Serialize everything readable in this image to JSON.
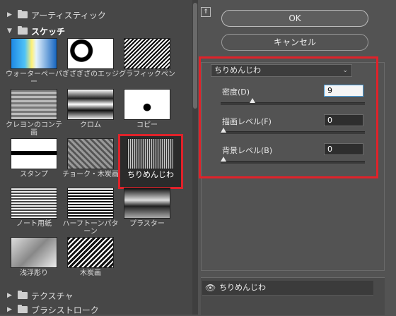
{
  "categories": {
    "artistic": "アーティスティック",
    "sketch": "スケッチ",
    "texture": "テクスチャ",
    "brush_stroke": "ブラシストローク"
  },
  "thumbnails": [
    {
      "label": "ウォーターペーパー"
    },
    {
      "label": "ぎざぎざのエッジ"
    },
    {
      "label": "グラフィックペン"
    },
    {
      "label": "クレヨンのコンテ画"
    },
    {
      "label": "クロム"
    },
    {
      "label": "コピー"
    },
    {
      "label": "スタンプ"
    },
    {
      "label": "チョーク・木炭画"
    },
    {
      "label": "ちりめんじわ"
    },
    {
      "label": "ノート用紙"
    },
    {
      "label": "ハーフトーンパターン"
    },
    {
      "label": "プラスター"
    },
    {
      "label": "浅浮彫り"
    },
    {
      "label": "木炭画"
    }
  ],
  "buttons": {
    "ok": "OK",
    "cancel": "キャンセル"
  },
  "filter_select": {
    "value": "ちりめんじわ"
  },
  "params": [
    {
      "label": "密度(D)",
      "value": "9",
      "level": 0.2
    },
    {
      "label": "描画レベル(F)",
      "value": "0",
      "level": 0.0
    },
    {
      "label": "背景レベル(B)",
      "value": "0",
      "level": 0.0
    }
  ],
  "layer": {
    "name": "ちりめんじわ"
  },
  "colors": {
    "highlight": "#e0222a",
    "panel": "#535353"
  }
}
